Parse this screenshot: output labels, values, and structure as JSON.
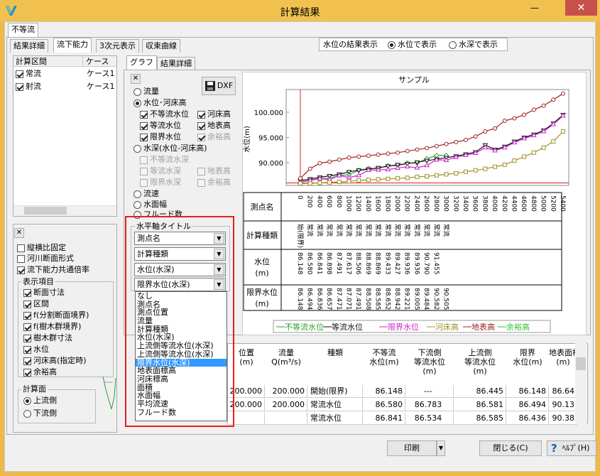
{
  "window": {
    "title": "計算結果",
    "close": "✕",
    "minimize": "—"
  },
  "top_tabs": [
    "不等流"
  ],
  "sub_tabs": [
    "結果詳細",
    "流下能力",
    "3次元表示",
    "収束曲線"
  ],
  "display_mode": {
    "label": "水位の結果表示",
    "option1": "水位で表示",
    "option2": "水深で表示"
  },
  "section_list": {
    "col1": "計算区間",
    "col2": "ケース",
    "rows": [
      {
        "name": "常流",
        "case": "ケース1"
      },
      {
        "name": "射流",
        "case": "ケース1"
      }
    ]
  },
  "inner_tabs": [
    "グラフ",
    "結果詳細"
  ],
  "graph_options": {
    "close_x": "✕",
    "dxf": "DXF",
    "flow": "流量",
    "water_level_bed": "水位･河床高",
    "nonuniform_wl": "不等流水位",
    "bed_height": "河床高",
    "uniform_wl": "等流水位",
    "ground_height": "地表高",
    "critical_wl": "限界水位",
    "margin_height": "余裕高",
    "depth_group": "水深(水位-河床高)",
    "d_nonuniform": "不等流水深",
    "d_uniform": "等流水深",
    "d_ground": "地表高",
    "d_critical": "限界水深",
    "d_margin": "余裕高",
    "velocity": "流速",
    "surface_width": "水面幅",
    "froude": "フルード数",
    "axis_title_group": "水平軸タイトル"
  },
  "dropdowns": [
    "測点名",
    "計算種類",
    "水位(水深)",
    "限界水位(水深)"
  ],
  "dropdown_list": [
    "なし",
    "測点名",
    "測点位置",
    "流量",
    "計算種類",
    "水位(水深)",
    "上流側等流水位(水深)",
    "上流側等流水位(水深)",
    "限界水位(水深)",
    "地表面標高",
    "河床標高",
    "面積",
    "水面幅",
    "平均流速",
    "フルード数"
  ],
  "options_panel": {
    "close_x": "✕",
    "fixed_ratio": "縦横比固定",
    "river_shape": "河川断面形式",
    "common_ratio": "流下能力共通倍率",
    "display_items": "表示項目",
    "section_dims": "断面寸法",
    "section": "区間",
    "f_sep": "f(分割断面境界)",
    "f_tree": "f(樹木群境界)",
    "tree_dims": "樹木群寸法",
    "water_level": "水位",
    "bed_spec": "河床高(指定時)",
    "margin": "余裕高",
    "calc_face": "計算面",
    "upstream": "上流側",
    "downstream": "下流側"
  },
  "chart_data": {
    "type": "line",
    "title": "サンプル",
    "ylabel": "水位(m)",
    "yticks": [
      "100.000",
      "95.000",
      "90.000"
    ],
    "ylim": [
      85.5,
      104.5
    ],
    "stations": [
      "0",
      "200",
      "400",
      "600",
      "800",
      "1000",
      "1200",
      "1400",
      "1600",
      "1800",
      "2000",
      "2200",
      "2400",
      "2600",
      "2800",
      "3000",
      "3200",
      "3400",
      "3600",
      "3800",
      "4000",
      "4200",
      "4400",
      "4600",
      "4800",
      "5000",
      "5200",
      "5400"
    ],
    "series": [
      {
        "name": "不等流水位",
        "color": "#2e9e2e",
        "marker": "diamond",
        "values": [
          86.148,
          86.58,
          86.841,
          86.898,
          87.491,
          87.617,
          88.506,
          88.869,
          88.869,
          89.433,
          89.427,
          89.936,
          89.936,
          90.79,
          91.455,
          91.455
        ]
      },
      {
        "name": "等流水位",
        "color": "#111111",
        "marker": "tri-down",
        "values": [
          86.445,
          86.78,
          87.1,
          87.4,
          87.7,
          88.2,
          88.5,
          88.7,
          89.0,
          89.3,
          89.6,
          89.8,
          90.1,
          90.4,
          90.7,
          91.0,
          91.3,
          91.7,
          92.1,
          93.5,
          92.6,
          93.2,
          94.2,
          95.0,
          95.6,
          96.4,
          97.8,
          99.5
        ]
      },
      {
        "name": "限界水位",
        "color": "#d020d0",
        "marker": "tri-up",
        "values": [
          86.148,
          86.494,
          86.836,
          86.657,
          87.471,
          87.071,
          87.491,
          88.508,
          88.585,
          88.652,
          88.942,
          89.221,
          89.005,
          89.484,
          90.582,
          90.505,
          91.1,
          91.5,
          91.9,
          93.0,
          92.4,
          93.0,
          94.0,
          94.8,
          95.4,
          96.2,
          97.6,
          99.3
        ]
      },
      {
        "name": "河床高",
        "color": "#a09020",
        "marker": "square",
        "values": [
          85.9,
          85.9,
          86.0,
          86.1,
          86.2,
          86.3,
          86.5,
          86.6,
          86.7,
          86.8,
          86.9,
          87.0,
          87.2,
          87.3,
          87.5,
          87.7,
          87.9,
          88.2,
          88.5,
          88.8,
          89.2,
          89.6,
          90.4,
          91.2,
          92.0,
          93.0,
          94.2,
          96.2
        ]
      },
      {
        "name": "地表高",
        "color": "#a02020",
        "marker": "circle",
        "values": [
          86.9,
          88.8,
          89.9,
          90.2,
          90.6,
          91.0,
          91.2,
          91.4,
          91.6,
          91.8,
          92.0,
          92.3,
          92.6,
          92.9,
          93.3,
          93.7,
          94.1,
          94.5,
          95.2,
          96.2,
          96.8,
          98.3,
          98.8,
          99.5,
          100.5,
          101.3,
          102.5,
          103.7
        ]
      },
      {
        "name": "余裕高",
        "color": "#30c030",
        "marker": "star",
        "values": []
      }
    ]
  },
  "table_rows": [
    {
      "label": "測点名",
      "vals": [
        "0",
        "200",
        "400",
        "600",
        "800",
        "1000",
        "1200",
        "1400",
        "1600",
        "1800",
        "2000",
        "2200",
        "2400",
        "2600",
        "2800",
        "3000",
        "3200",
        "3400",
        "3600",
        "3800",
        "4000",
        "4200",
        "4400",
        "4600",
        "4800",
        "5000",
        "5200",
        "5400"
      ]
    },
    {
      "label": "計算種類",
      "vals": [
        "始(限界)",
        "常流",
        "常流",
        "常流",
        "常流",
        "常流",
        "常流",
        "常流",
        "常流",
        "常流",
        "常流",
        "常流",
        "常流",
        "常流",
        "常流",
        "常流"
      ]
    },
    {
      "label": "水位\n(m)",
      "vals": [
        "86.148",
        "86.580",
        "86.841",
        "86.898",
        "87.491",
        "87.617",
        "88.506",
        "88.869",
        "88.869",
        "89.433",
        "89.427",
        "89.936",
        "89.936",
        "90.790",
        "91.455"
      ]
    },
    {
      "label": "限界水位\n(m)",
      "vals": [
        "86.148",
        "86.494",
        "86.836",
        "86.657",
        "87.471",
        "87.071",
        "87.491",
        "88.508",
        "88.585",
        "88.652",
        "88.942",
        "89.221",
        "89.005",
        "89.484",
        "90.582",
        "90.505"
      ]
    }
  ],
  "detail_table": {
    "headers": [
      "位置\n(m)",
      "流量\nQ(m³/s)",
      "種類",
      "不等流\n水位(m)",
      "下流側\n等流水位\n(m)",
      "上流側\n等流水位\n(m)",
      "限界\n水位(m)",
      "地表面標\n(m)"
    ],
    "rows": [
      [
        "200.000",
        "200.000",
        "開始(限界)",
        "86.148",
        "---",
        "86.445",
        "86.148",
        "86.64"
      ],
      [
        "200.000",
        "200.000",
        "常流水位",
        "86.580",
        "86.783",
        "86.581",
        "86.494",
        "90.13"
      ],
      [
        "",
        "",
        "常流水位",
        "86.841",
        "86.534",
        "86.585",
        "86.436",
        "90.38"
      ]
    ]
  },
  "bottom_bar": {
    "print": "印刷",
    "close": "閉じる(C)",
    "help": "ﾍﾙﾌﾟ(H)"
  }
}
